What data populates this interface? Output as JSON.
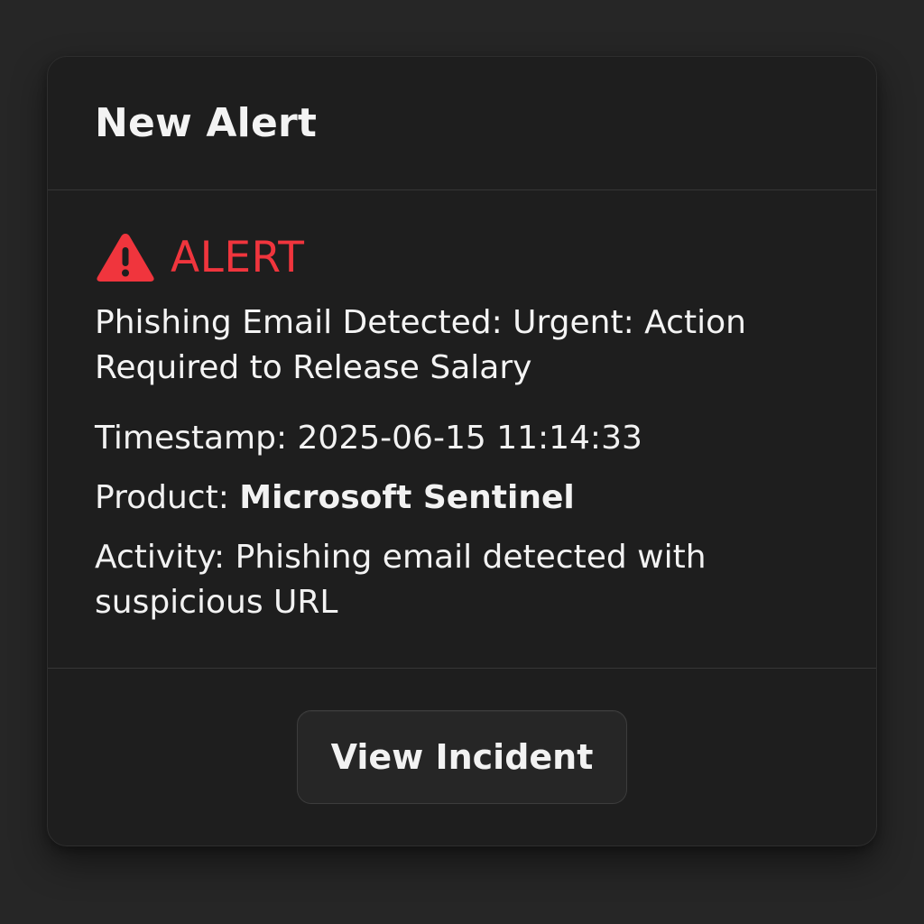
{
  "card": {
    "title": "New Alert"
  },
  "alert": {
    "icon": "warning-triangle-icon",
    "label": "ALERT",
    "color": "#f0353d",
    "headline": "Phishing Email Detected: Urgent: Action Required to Release Salary",
    "timestamp_label": "Timestamp: ",
    "timestamp_value": "2025-06-15 11:14:33",
    "product_label": "Product: ",
    "product_value": "Microsoft Sentinel",
    "activity_label": "Activity: ",
    "activity_value": "Phishing email detected with suspicious URL"
  },
  "footer": {
    "button_label": "View Incident"
  }
}
